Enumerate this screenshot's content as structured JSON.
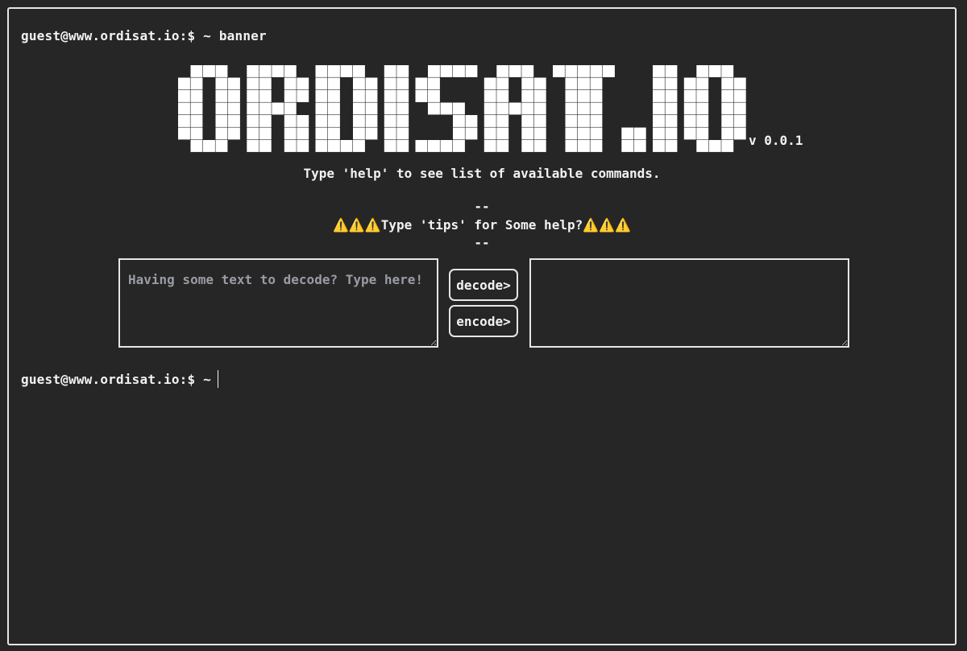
{
  "terminal": {
    "prompt": "guest@www.ordisat.io:$ ~",
    "history_command": "banner",
    "current_input": ""
  },
  "banner": {
    "logo_text": "ORDISAT.IO",
    "version": "v 0.0.1"
  },
  "messages": {
    "help": "Type 'help' to see list of available commands.",
    "separator_top": "--",
    "tips_prefix_icon": "⚠️⚠️⚠️",
    "tips": "Type 'tips' for Some help?",
    "tips_suffix_icon": "⚠️⚠️⚠️",
    "separator_bottom": "--"
  },
  "codec": {
    "input_placeholder": "Having some text to decode? Type here!",
    "input_value": "",
    "output_value": "",
    "decode_label": "decode>",
    "encode_label": "encode>"
  },
  "colors": {
    "background": "#262626",
    "foreground": "#f2f2f2",
    "border": "#e6e6e6",
    "placeholder": "#9a9ca4",
    "warning": "#f5c518"
  }
}
